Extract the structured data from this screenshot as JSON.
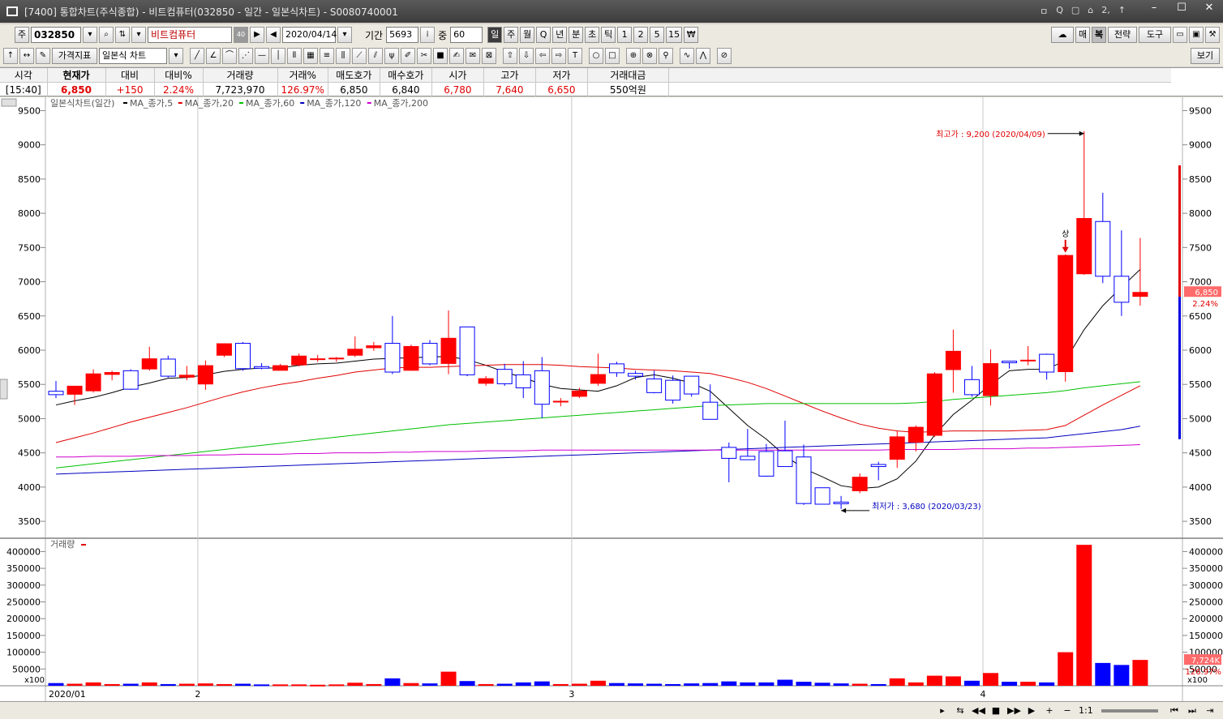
{
  "window": {
    "title": "[7400] 통합차트(주식종합) - 비트컴퓨터(032850 - 일간 - 일본식차트) - S0080740001",
    "tools": [
      "ㅁ",
      "Q",
      "▢",
      "⌂",
      "2,",
      "↑"
    ]
  },
  "toolbar": {
    "market": "주",
    "code": "032850",
    "name": "비트컴퓨터",
    "name_badge": "40",
    "date": "2020/04/14",
    "period_label": "기간",
    "period_value": "5693",
    "mid_label": "중",
    "mid_value": "60",
    "timeframes": [
      "일",
      "주",
      "월",
      "Q",
      "년",
      "분",
      "초",
      "틱",
      "1",
      "2",
      "5",
      "15",
      "₩"
    ],
    "selected_timeframe": "일",
    "right_buttons": [
      "매",
      "복",
      "전략",
      "도구"
    ],
    "indicator": "가격지표",
    "chart_type": "일본식 차트",
    "view_button": "보기"
  },
  "quote": {
    "headers": [
      "시각",
      "현재가",
      "대비",
      "대비%",
      "거래량",
      "거래%",
      "매도호가",
      "매수호가",
      "시가",
      "고가",
      "저가",
      "거래대금"
    ],
    "values": [
      "[15:40]",
      "6,850",
      "+150",
      "2.24%",
      "7,723,970",
      "126.97%",
      "6,850",
      "6,840",
      "6,780",
      "7,640",
      "6,650",
      "550억원"
    ]
  },
  "chart_data": {
    "type": "candlestick",
    "legend": "일본식차트(일간)",
    "ma_labels": [
      "MA_종가,5",
      "MA_종가,20",
      "MA_종가,60",
      "MA_종가,120",
      "MA_종가,200"
    ],
    "ma_colors": [
      "#000000",
      "#e00000",
      "#00c000",
      "#0000c0",
      "#d000d0"
    ],
    "price_ylim": [
      3300,
      9600
    ],
    "price_ticks": [
      3500,
      4000,
      4500,
      5000,
      5500,
      6000,
      6500,
      7000,
      7500,
      8000,
      8500,
      9000,
      9500
    ],
    "up_color": "#ff0000",
    "down_color": "#0000ff",
    "month_labels": [
      "2020/01",
      "2",
      "3",
      "4"
    ],
    "month_index": [
      0,
      8,
      28,
      50
    ],
    "candles": [
      [
        5400,
        5550,
        5300,
        5350
      ],
      [
        5350,
        5450,
        5200,
        5480
      ],
      [
        5400,
        5720,
        5380,
        5660
      ],
      [
        5640,
        5700,
        5560,
        5680
      ],
      [
        5700,
        5720,
        5420,
        5430
      ],
      [
        5720,
        6050,
        5700,
        5880
      ],
      [
        5870,
        5920,
        5600,
        5620
      ],
      [
        5600,
        5770,
        5560,
        5640
      ],
      [
        5500,
        5850,
        5420,
        5780
      ],
      [
        5920,
        6100,
        5900,
        6100
      ],
      [
        6100,
        6120,
        5700,
        5730
      ],
      [
        5760,
        5810,
        5720,
        5740
      ],
      [
        5700,
        5800,
        5720,
        5780
      ],
      [
        5780,
        5950,
        5760,
        5920
      ],
      [
        5870,
        5930,
        5830,
        5880
      ],
      [
        5880,
        5900,
        5830,
        5890
      ],
      [
        5920,
        6200,
        5900,
        6020
      ],
      [
        6030,
        6120,
        5990,
        6070
      ],
      [
        6100,
        6500,
        5650,
        5680
      ],
      [
        5700,
        6080,
        5700,
        6060
      ],
      [
        6100,
        6150,
        5780,
        5800
      ],
      [
        5800,
        6580,
        5650,
        6180
      ],
      [
        6340,
        6340,
        5620,
        5640
      ],
      [
        5510,
        5620,
        5480,
        5590
      ],
      [
        5720,
        5800,
        5480,
        5510
      ],
      [
        5640,
        5840,
        5300,
        5450
      ],
      [
        5700,
        5900,
        5010,
        5210
      ],
      [
        5240,
        5300,
        5180,
        5260
      ],
      [
        5320,
        5450,
        5300,
        5410
      ],
      [
        5510,
        5950,
        5480,
        5650
      ],
      [
        5800,
        5830,
        5610,
        5670
      ],
      [
        5660,
        5700,
        5570,
        5620
      ],
      [
        5580,
        5700,
        5370,
        5380
      ],
      [
        5560,
        5630,
        5220,
        5270
      ],
      [
        5620,
        5620,
        5320,
        5360
      ],
      [
        5240,
        5500,
        4990,
        4990
      ],
      [
        4580,
        4650,
        4070,
        4420
      ],
      [
        4450,
        4850,
        4400,
        4400
      ],
      [
        4520,
        4630,
        4150,
        4160
      ],
      [
        4530,
        4970,
        4300,
        4300
      ],
      [
        4440,
        4620,
        3740,
        3760
      ],
      [
        3990,
        3990,
        3760,
        3750
      ],
      [
        3780,
        3870,
        3680,
        3770
      ],
      [
        3940,
        4200,
        3910,
        4150
      ],
      [
        4330,
        4370,
        4100,
        4300
      ],
      [
        4400,
        4820,
        4280,
        4740
      ],
      [
        4650,
        4900,
        4520,
        4880
      ],
      [
        4750,
        5680,
        4730,
        5660
      ],
      [
        5710,
        6300,
        5380,
        5990
      ],
      [
        5570,
        5770,
        5320,
        5350
      ],
      [
        5330,
        6010,
        5190,
        5810
      ],
      [
        5840,
        5840,
        5730,
        5830
      ],
      [
        5860,
        6060,
        5780,
        5860
      ],
      [
        5940,
        5950,
        5570,
        5680
      ],
      [
        5680,
        7400,
        5540,
        7390
      ],
      [
        7110,
        9200,
        7100,
        7930
      ],
      [
        7880,
        8300,
        6980,
        7080
      ],
      [
        7080,
        7750,
        6500,
        6700
      ],
      [
        6780,
        7640,
        6650,
        6850
      ]
    ],
    "ma5": [
      5200,
      5260,
      5310,
      5380,
      5460,
      5520,
      5590,
      5600,
      5640,
      5690,
      5720,
      5740,
      5740,
      5780,
      5800,
      5810,
      5840,
      5870,
      5880,
      5890,
      5900,
      5910,
      5860,
      5780,
      5680,
      5600,
      5500,
      5440,
      5420,
      5400,
      5480,
      5600,
      5640,
      5590,
      5520,
      5400,
      5150,
      4900,
      4700,
      4460,
      4270,
      4150,
      4020,
      3980,
      4000,
      4120,
      4380,
      4760,
      5060,
      5270,
      5500,
      5700,
      5720,
      5720,
      5850,
      6300,
      6650,
      6920,
      7180
    ],
    "ma20": [
      4650,
      4720,
      4790,
      4870,
      4950,
      5020,
      5090,
      5160,
      5240,
      5320,
      5390,
      5450,
      5500,
      5540,
      5590,
      5630,
      5680,
      5710,
      5740,
      5750,
      5750,
      5760,
      5770,
      5780,
      5790,
      5790,
      5790,
      5780,
      5760,
      5750,
      5740,
      5720,
      5710,
      5700,
      5680,
      5660,
      5600,
      5530,
      5440,
      5330,
      5220,
      5110,
      5010,
      4920,
      4860,
      4820,
      4800,
      4810,
      4820,
      4820,
      4820,
      4820,
      4830,
      4840,
      4900,
      5050,
      5200,
      5340,
      5480
    ],
    "ma60": [
      4280,
      4310,
      4340,
      4370,
      4400,
      4430,
      4460,
      4490,
      4520,
      4550,
      4580,
      4610,
      4640,
      4670,
      4700,
      4730,
      4760,
      4790,
      4820,
      4850,
      4880,
      4910,
      4930,
      4950,
      4970,
      4990,
      5010,
      5030,
      5050,
      5070,
      5090,
      5110,
      5130,
      5150,
      5170,
      5190,
      5200,
      5210,
      5220,
      5220,
      5220,
      5220,
      5220,
      5220,
      5220,
      5220,
      5230,
      5250,
      5280,
      5300,
      5320,
      5340,
      5360,
      5380,
      5410,
      5450,
      5480,
      5510,
      5540
    ],
    "ma120": [
      4190,
      4200,
      4210,
      4220,
      4230,
      4240,
      4250,
      4260,
      4270,
      4280,
      4290,
      4300,
      4310,
      4320,
      4330,
      4340,
      4350,
      4360,
      4370,
      4380,
      4390,
      4400,
      4410,
      4420,
      4430,
      4440,
      4450,
      4460,
      4470,
      4480,
      4490,
      4500,
      4510,
      4520,
      4530,
      4540,
      4550,
      4560,
      4570,
      4580,
      4590,
      4600,
      4610,
      4620,
      4630,
      4640,
      4650,
      4660,
      4670,
      4680,
      4690,
      4700,
      4710,
      4720,
      4750,
      4780,
      4810,
      4840,
      4890
    ],
    "ma200": [
      4440,
      4440,
      4450,
      4450,
      4450,
      4460,
      4460,
      4460,
      4470,
      4470,
      4480,
      4480,
      4480,
      4490,
      4490,
      4500,
      4500,
      4500,
      4510,
      4510,
      4520,
      4520,
      4520,
      4530,
      4530,
      4530,
      4540,
      4540,
      4540,
      4540,
      4540,
      4540,
      4540,
      4540,
      4540,
      4540,
      4540,
      4540,
      4540,
      4540,
      4540,
      4540,
      4540,
      4540,
      4540,
      4550,
      4550,
      4550,
      4550,
      4560,
      4560,
      4560,
      4570,
      4570,
      4580,
      4590,
      4600,
      4610,
      4620
    ],
    "annotation_high": "최고가 : 9,200 (2020/04/09)",
    "annotation_low": "최저가 : 3,680 (2020/03/23)",
    "limit_up_label": "상",
    "last_price_label": "6,850",
    "last_change_label": "2.24%",
    "volume": {
      "legend": "거래량",
      "ylim": [
        0,
        430000
      ],
      "ticks": [
        50000,
        100000,
        150000,
        200000,
        250000,
        300000,
        350000,
        400000
      ],
      "tick_labels": [
        "50000",
        "100000",
        "150000",
        "200000",
        "250000",
        "300000",
        "350000",
        "400000"
      ],
      "unit_label": "x100",
      "last_label": "7,724K",
      "last_pct": "126.97%",
      "values": [
        8000,
        6000,
        10000,
        5000,
        6000,
        10000,
        5000,
        6000,
        7000,
        5000,
        6000,
        4000,
        4000,
        4000,
        3000,
        4000,
        9000,
        5000,
        22000,
        8000,
        7000,
        42000,
        14000,
        5000,
        6000,
        10000,
        13000,
        5000,
        6000,
        15000,
        8000,
        7000,
        6000,
        5000,
        7000,
        8000,
        13000,
        10000,
        10000,
        18000,
        12000,
        9000,
        7000,
        6000,
        5000,
        22000,
        10000,
        30000,
        28000,
        15000,
        38000,
        12000,
        12000,
        10000,
        100000,
        420000,
        68000,
        62000,
        77000
      ]
    }
  }
}
